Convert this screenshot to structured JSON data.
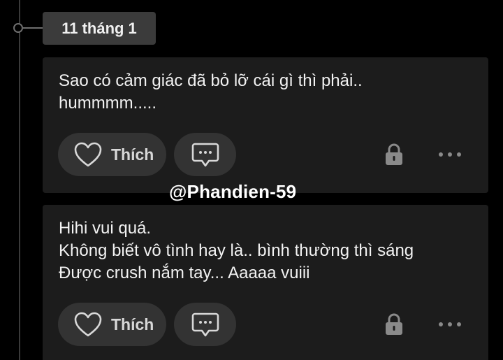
{
  "date_label": "11 tháng 1",
  "watermark": "@Phandien-59",
  "posts": [
    {
      "text": "Sao có cảm giác đã bỏ lỡ cái gì thì phải..\nhummmm.....",
      "like_label": "Thích",
      "privacy_icon": "lock-icon",
      "more_icon": "more-horizontal-icon"
    },
    {
      "text": "Hihi vui quá.\nKhông biết vô tình hay là.. bình thường thì sáng\nĐược crush nắm tay... Aaaaa vuiii",
      "like_label": "Thích",
      "privacy_icon": "lock-icon",
      "more_icon": "more-horizontal-icon"
    }
  ],
  "colors": {
    "background": "#000000",
    "card": "#1c1c1c",
    "button": "#333333",
    "date_pill": "#3b3b3b",
    "icon": "#d8d8d8",
    "muted_icon": "#8a8a8a"
  }
}
